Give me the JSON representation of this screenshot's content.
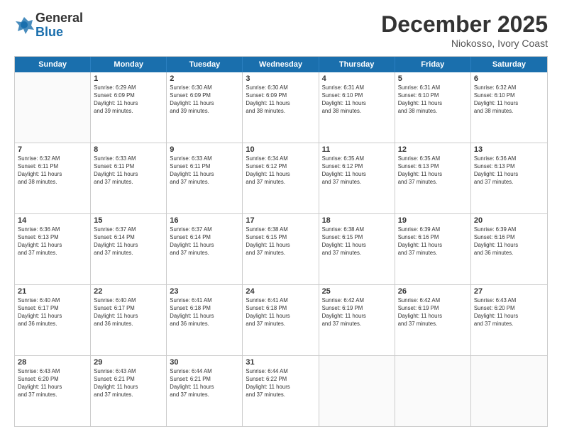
{
  "logo": {
    "general": "General",
    "blue": "Blue"
  },
  "title": "December 2025",
  "subtitle": "Niokosso, Ivory Coast",
  "header_days": [
    "Sunday",
    "Monday",
    "Tuesday",
    "Wednesday",
    "Thursday",
    "Friday",
    "Saturday"
  ],
  "weeks": [
    [
      {
        "day": "",
        "info": ""
      },
      {
        "day": "1",
        "info": "Sunrise: 6:29 AM\nSunset: 6:09 PM\nDaylight: 11 hours\nand 39 minutes."
      },
      {
        "day": "2",
        "info": "Sunrise: 6:30 AM\nSunset: 6:09 PM\nDaylight: 11 hours\nand 39 minutes."
      },
      {
        "day": "3",
        "info": "Sunrise: 6:30 AM\nSunset: 6:09 PM\nDaylight: 11 hours\nand 38 minutes."
      },
      {
        "day": "4",
        "info": "Sunrise: 6:31 AM\nSunset: 6:10 PM\nDaylight: 11 hours\nand 38 minutes."
      },
      {
        "day": "5",
        "info": "Sunrise: 6:31 AM\nSunset: 6:10 PM\nDaylight: 11 hours\nand 38 minutes."
      },
      {
        "day": "6",
        "info": "Sunrise: 6:32 AM\nSunset: 6:10 PM\nDaylight: 11 hours\nand 38 minutes."
      }
    ],
    [
      {
        "day": "7",
        "info": "Sunrise: 6:32 AM\nSunset: 6:11 PM\nDaylight: 11 hours\nand 38 minutes."
      },
      {
        "day": "8",
        "info": "Sunrise: 6:33 AM\nSunset: 6:11 PM\nDaylight: 11 hours\nand 37 minutes."
      },
      {
        "day": "9",
        "info": "Sunrise: 6:33 AM\nSunset: 6:11 PM\nDaylight: 11 hours\nand 37 minutes."
      },
      {
        "day": "10",
        "info": "Sunrise: 6:34 AM\nSunset: 6:12 PM\nDaylight: 11 hours\nand 37 minutes."
      },
      {
        "day": "11",
        "info": "Sunrise: 6:35 AM\nSunset: 6:12 PM\nDaylight: 11 hours\nand 37 minutes."
      },
      {
        "day": "12",
        "info": "Sunrise: 6:35 AM\nSunset: 6:13 PM\nDaylight: 11 hours\nand 37 minutes."
      },
      {
        "day": "13",
        "info": "Sunrise: 6:36 AM\nSunset: 6:13 PM\nDaylight: 11 hours\nand 37 minutes."
      }
    ],
    [
      {
        "day": "14",
        "info": "Sunrise: 6:36 AM\nSunset: 6:13 PM\nDaylight: 11 hours\nand 37 minutes."
      },
      {
        "day": "15",
        "info": "Sunrise: 6:37 AM\nSunset: 6:14 PM\nDaylight: 11 hours\nand 37 minutes."
      },
      {
        "day": "16",
        "info": "Sunrise: 6:37 AM\nSunset: 6:14 PM\nDaylight: 11 hours\nand 37 minutes."
      },
      {
        "day": "17",
        "info": "Sunrise: 6:38 AM\nSunset: 6:15 PM\nDaylight: 11 hours\nand 37 minutes."
      },
      {
        "day": "18",
        "info": "Sunrise: 6:38 AM\nSunset: 6:15 PM\nDaylight: 11 hours\nand 37 minutes."
      },
      {
        "day": "19",
        "info": "Sunrise: 6:39 AM\nSunset: 6:16 PM\nDaylight: 11 hours\nand 37 minutes."
      },
      {
        "day": "20",
        "info": "Sunrise: 6:39 AM\nSunset: 6:16 PM\nDaylight: 11 hours\nand 36 minutes."
      }
    ],
    [
      {
        "day": "21",
        "info": "Sunrise: 6:40 AM\nSunset: 6:17 PM\nDaylight: 11 hours\nand 36 minutes."
      },
      {
        "day": "22",
        "info": "Sunrise: 6:40 AM\nSunset: 6:17 PM\nDaylight: 11 hours\nand 36 minutes."
      },
      {
        "day": "23",
        "info": "Sunrise: 6:41 AM\nSunset: 6:18 PM\nDaylight: 11 hours\nand 36 minutes."
      },
      {
        "day": "24",
        "info": "Sunrise: 6:41 AM\nSunset: 6:18 PM\nDaylight: 11 hours\nand 37 minutes."
      },
      {
        "day": "25",
        "info": "Sunrise: 6:42 AM\nSunset: 6:19 PM\nDaylight: 11 hours\nand 37 minutes."
      },
      {
        "day": "26",
        "info": "Sunrise: 6:42 AM\nSunset: 6:19 PM\nDaylight: 11 hours\nand 37 minutes."
      },
      {
        "day": "27",
        "info": "Sunrise: 6:43 AM\nSunset: 6:20 PM\nDaylight: 11 hours\nand 37 minutes."
      }
    ],
    [
      {
        "day": "28",
        "info": "Sunrise: 6:43 AM\nSunset: 6:20 PM\nDaylight: 11 hours\nand 37 minutes."
      },
      {
        "day": "29",
        "info": "Sunrise: 6:43 AM\nSunset: 6:21 PM\nDaylight: 11 hours\nand 37 minutes."
      },
      {
        "day": "30",
        "info": "Sunrise: 6:44 AM\nSunset: 6:21 PM\nDaylight: 11 hours\nand 37 minutes."
      },
      {
        "day": "31",
        "info": "Sunrise: 6:44 AM\nSunset: 6:22 PM\nDaylight: 11 hours\nand 37 minutes."
      },
      {
        "day": "",
        "info": ""
      },
      {
        "day": "",
        "info": ""
      },
      {
        "day": "",
        "info": ""
      }
    ]
  ]
}
